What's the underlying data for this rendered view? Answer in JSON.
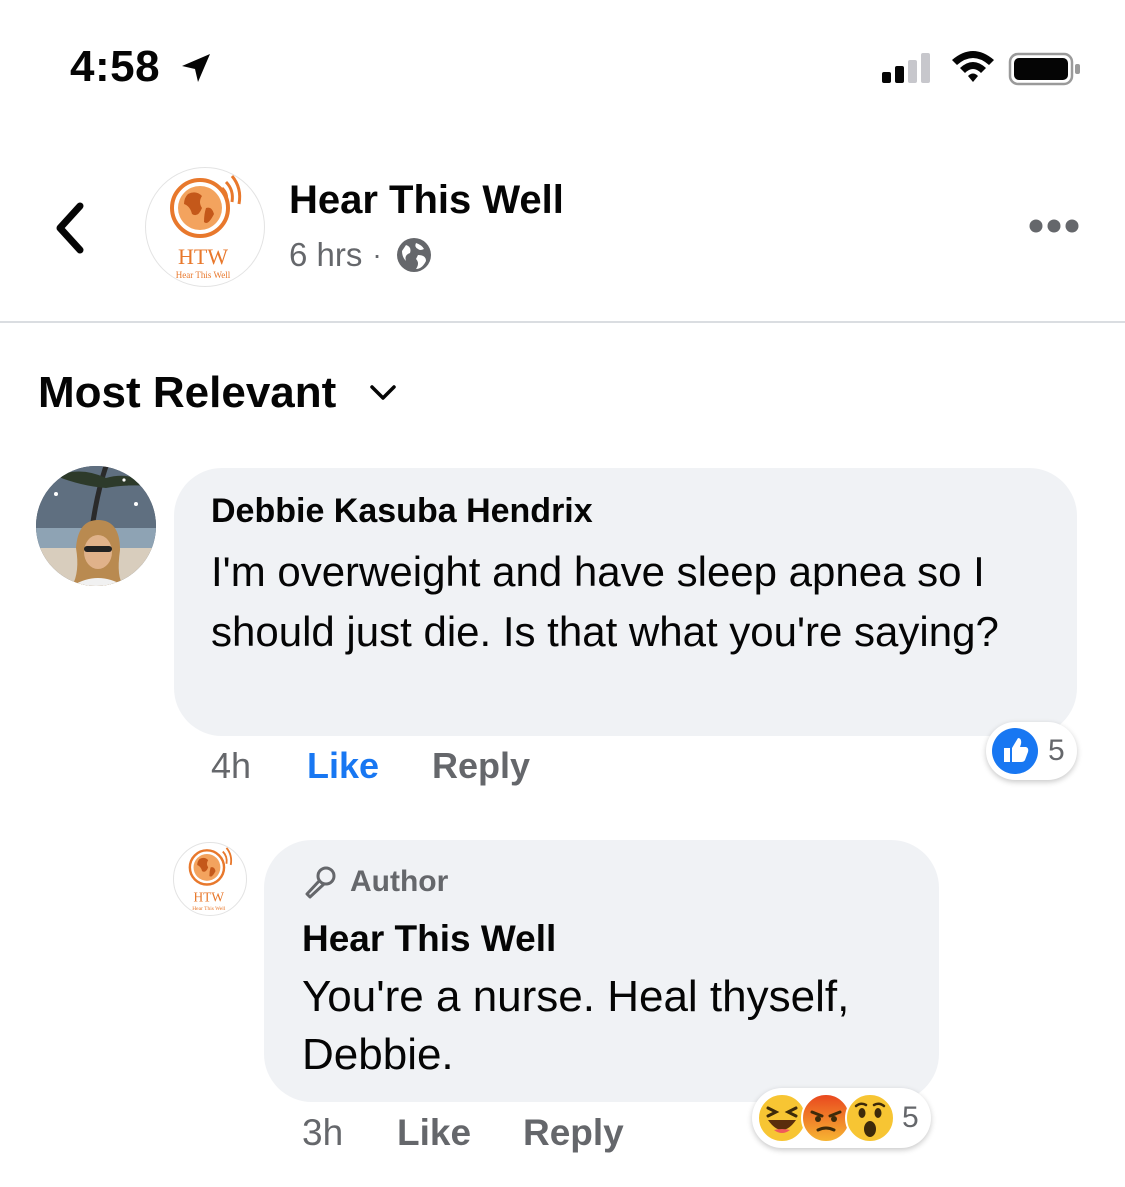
{
  "status_bar": {
    "time": "4:58"
  },
  "header": {
    "page_name": "Hear This Well",
    "post_time": "6 hrs",
    "separator": "·",
    "logo_text": "HTW",
    "logo_subtext": "Hear This Well",
    "colors": {
      "logo_orange": "#e8782c"
    }
  },
  "sort": {
    "label": "Most Relevant"
  },
  "comments": [
    {
      "author": "Debbie Kasuba Hendrix",
      "text": "I'm overweight and have sleep apnea so I should just die. Is that what you're saying?",
      "time": "4h",
      "like_label": "Like",
      "reply_label": "Reply",
      "reaction_count": "5",
      "reactions": [
        "like"
      ],
      "liked": true
    },
    {
      "badge": "Author",
      "author": "Hear This Well",
      "text": "You're a nurse. Heal thyself, Debbie.",
      "time": "3h",
      "like_label": "Like",
      "reply_label": "Reply",
      "reaction_count": "5",
      "reactions": [
        "haha",
        "angry",
        "wow"
      ]
    }
  ],
  "colors": {
    "accent": "#1877f2",
    "secondary_text": "#65676b",
    "bubble": "#f0f2f5"
  }
}
